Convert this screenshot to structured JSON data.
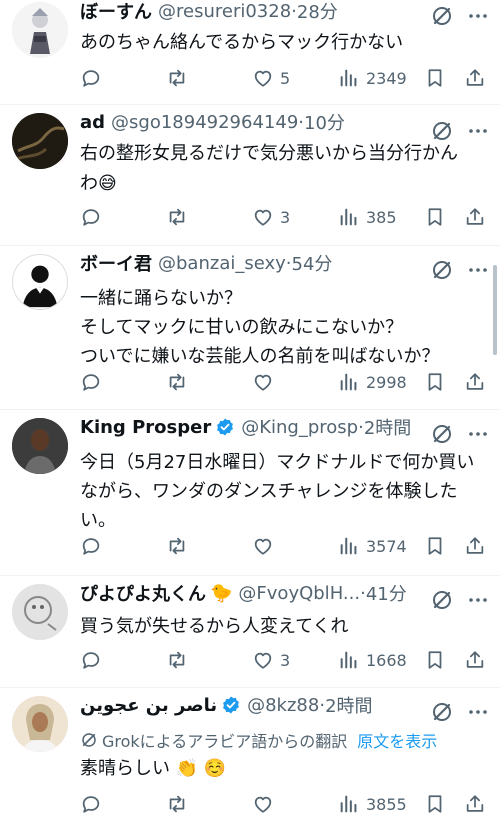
{
  "tweets": [
    {
      "name": "ぼーすん",
      "handle": "@resureri0328",
      "sep": "·",
      "time": "28分",
      "text": "あのちゃん絡んでるからマック行かない",
      "reply": "",
      "retweet": "",
      "likes": "5",
      "views": "2349"
    },
    {
      "name": "ad",
      "handle": "@sgo189492964149",
      "sep": "·",
      "time": "10分",
      "text": "右の整形女見るだけで気分悪いから当分行かんわ",
      "emoji": "😅",
      "reply": "",
      "retweet": "",
      "likes": "3",
      "views": "385"
    },
    {
      "name": "ボーイ君",
      "handle": "@banzai_sexy",
      "sep": "·",
      "time": "54分",
      "text": "一緒に踊らないか？\nそしてマックに甘いの飲みにこないか？\nついでに嫌いな芸能人の名前を叫ばないか？",
      "reply": "",
      "retweet": "",
      "likes": "",
      "views": "2998"
    },
    {
      "name": "King Prosper",
      "handle": "@King_prosp",
      "sep": "·",
      "time": "2時間",
      "text": "今日（5月27日水曜日）マクドナルドで何か買いながら、ワンダのダンスチャレンジを体験したい。",
      "reply": "",
      "retweet": "",
      "likes": "",
      "views": "3574"
    },
    {
      "name": "ぴよぴよ丸くん",
      "name_emoji": "🐤",
      "handle": "@FvoyQblH...",
      "sep": "·",
      "time": "41分",
      "text": "買う気が失せるから人変えてくれ",
      "reply": "",
      "retweet": "",
      "likes": "3",
      "views": "1668"
    },
    {
      "name": "ناصر بن عجوين",
      "handle": "@8kz88",
      "sep": "·",
      "time": "2時間",
      "translation": "Grokによるアラビア語からの翻訳",
      "show_original": "原文を表示",
      "text": "素晴らしい",
      "emoji": "👏 ☺️",
      "views": "3855"
    }
  ],
  "colors": {
    "text": "#0f1419",
    "muted": "#536471",
    "link": "#1d9bf0",
    "verified": "#1d9bf0"
  },
  "icons": [
    "reply-icon",
    "retweet-icon",
    "like-icon",
    "views-icon",
    "bookmark-icon",
    "share-icon",
    "grok-icon",
    "verified-icon"
  ]
}
